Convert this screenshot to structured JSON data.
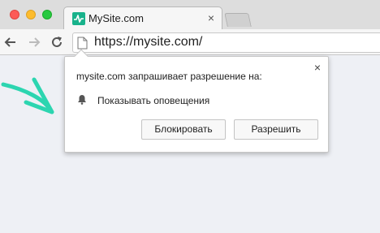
{
  "tab": {
    "title": "MySite.com",
    "close": "×"
  },
  "address_bar": {
    "url": "https://mysite.com/"
  },
  "popup": {
    "title": "mysite.com запрашивает разрешение на:",
    "permission": "Показывать оповещения",
    "close": "×",
    "block_label": "Блокировать",
    "allow_label": "Разрешить"
  },
  "colors": {
    "favicon": "#18b28b",
    "arrow": "#2cd5b0",
    "page_background": "#eef0f5"
  },
  "icons": {
    "favicon": "pulse-icon",
    "back": "arrow-left-icon",
    "forward": "arrow-right-icon",
    "reload": "reload-icon",
    "page": "page-icon",
    "permission": "bell-icon",
    "pointer": "curved-arrow-icon"
  }
}
